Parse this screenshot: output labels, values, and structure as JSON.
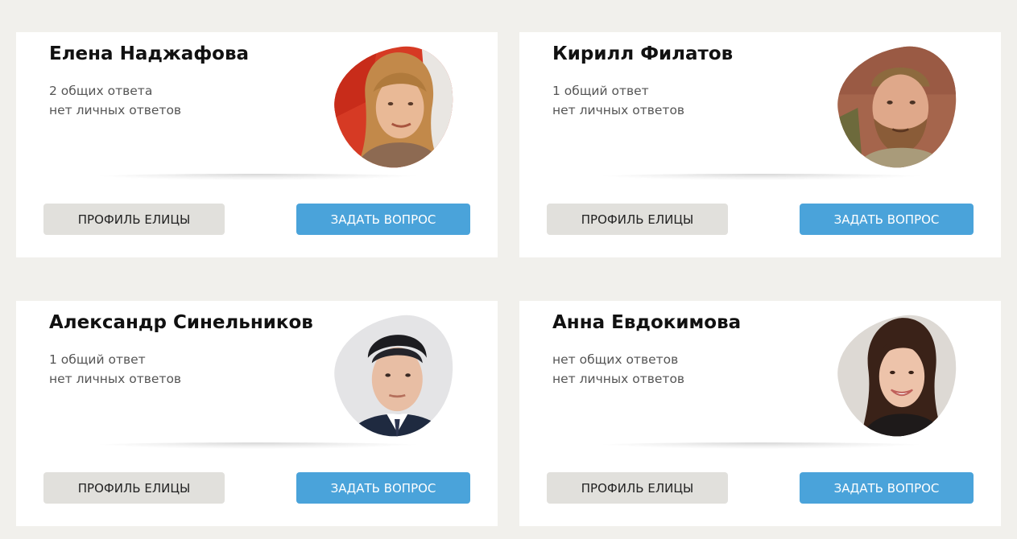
{
  "page": {
    "background_color": "#f1f0ec",
    "card_color": "#ffffff",
    "accent_color": "#4aa3da",
    "secondary_button_color": "#e1e0dc"
  },
  "experts": [
    {
      "name": "Елена Наджафова",
      "common_answers": "2 общих ответа",
      "personal_answers": "нет личных ответов",
      "profile_button": "ПРОФИЛЬ ЕЛИЦЫ",
      "ask_button": "ЗАДАТЬ ВОПРОС",
      "photo": "woman-red-background-portrait"
    },
    {
      "name": "Кирилл Филатов",
      "common_answers": "1 общий ответ",
      "personal_answers": "нет личных ответов",
      "profile_button": "ПРОФИЛЬ ЕЛИЦЫ",
      "ask_button": "ЗАДАТЬ ВОПРОС",
      "photo": "bearded-man-portrait"
    },
    {
      "name": "Александр Синельников",
      "common_answers": "1 общий ответ",
      "personal_answers": "нет личных ответов",
      "profile_button": "ПРОФИЛЬ ЕЛИЦЫ",
      "ask_button": "ЗАДАТЬ ВОПРОС",
      "photo": "man-suit-portrait"
    },
    {
      "name": "Анна Евдокимова",
      "common_answers": "нет общих ответов",
      "personal_answers": "нет личных ответов",
      "profile_button": "ПРОФИЛЬ ЕЛИЦЫ",
      "ask_button": "ЗАДАТЬ ВОПРОС",
      "photo": "smiling-woman-portrait"
    }
  ]
}
